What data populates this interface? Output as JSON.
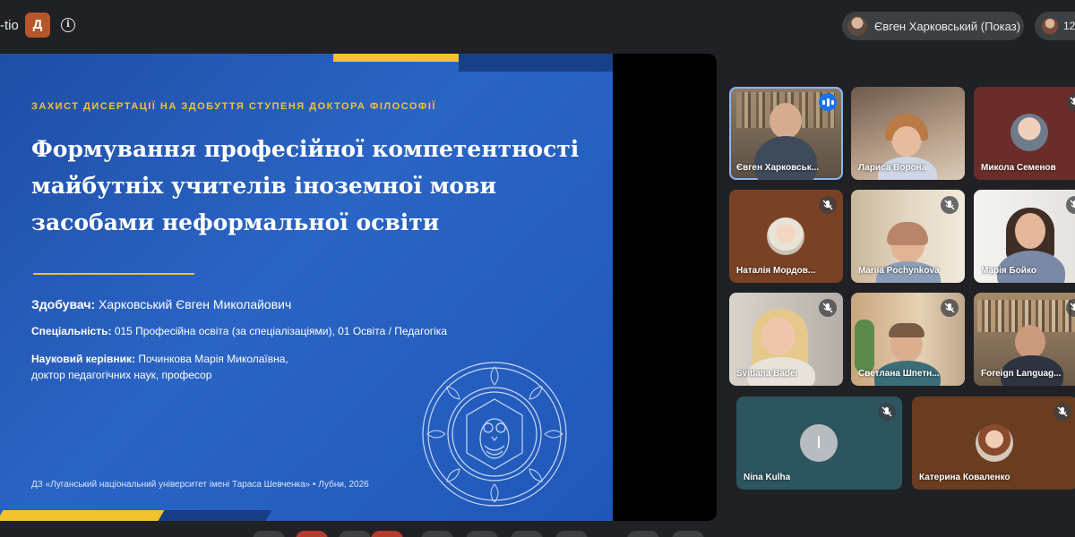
{
  "topbar": {
    "meeting_code": "-tio",
    "host_badge": "Д",
    "info_icon": "info-icon",
    "presenter_chip": "Євген Харковський (Показ)",
    "participant_count": "12"
  },
  "slide": {
    "kicker": "ЗАХИСТ ДИСЕРТАЦІЇ НА ЗДОБУТТЯ СТУПЕНЯ ДОКТОРА ФІЛОСОФІЇ",
    "title_lines": [
      "Формування професійної компетентності",
      "майбутніх учителів іноземної мови",
      "засобами неформальної освіти"
    ],
    "applicant_label": "Здобувач:",
    "applicant_value": " Харковський Євген Миколайович",
    "specialty_label": "Спеціальність:",
    "specialty_value": " 015 Професійна освіта (за спеціалізаціями), 01 Освіта / Педагогіка",
    "advisor_label": "Науковий керівник:",
    "advisor_value": " Починкова Марія Миколаївна,",
    "advisor_title": "доктор педагогічних наук, професор",
    "footer": "ДЗ «Луганський національний університет імені Тараса Шевченка»  •  Лубни, 2026"
  },
  "participants": [
    {
      "name": "Євген Харковськ...",
      "state": "speaking"
    },
    {
      "name": "Лариса Ворона",
      "state": "none"
    },
    {
      "name": "Микола Семенов",
      "state": "muted"
    },
    {
      "name": "Наталія Мордов...",
      "state": "muted"
    },
    {
      "name": "Mariia Pochynkova",
      "state": "muted"
    },
    {
      "name": "Марія Бойко",
      "state": "muted"
    },
    {
      "name": "Svitlana Bader",
      "state": "muted"
    },
    {
      "name": "Светлана Шпетн...",
      "state": "muted"
    },
    {
      "name": "Foreign Languag...",
      "state": "muted"
    },
    {
      "name": "Nina Kulha",
      "state": "muted",
      "avatar_letter": "I"
    },
    {
      "name": "Катерина Коваленко",
      "state": "muted"
    }
  ],
  "colors": {
    "background": "#202124",
    "slide_blue": "#2a64c4",
    "slide_gold": "#f2c230",
    "speaking_blue": "#1a73e8"
  }
}
